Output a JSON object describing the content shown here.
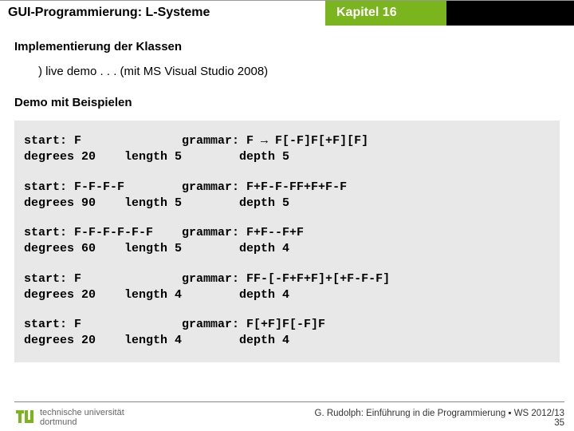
{
  "header": {
    "left": "GUI-Programmierung: L-Systeme",
    "right": "Kapitel 16"
  },
  "section1": {
    "title": "Implementierung der Klassen",
    "bullet": ") live demo . . . (mit MS Visual Studio 2008)"
  },
  "section2": {
    "title": "Demo mit Beispielen"
  },
  "examples": [
    {
      "line1": "start: F              grammar: F → F[-F]F[+F][F]",
      "line2": "degrees 20    length 5        depth 5"
    },
    {
      "line1": "start: F-F-F-F        grammar: F+F-F-FF+F+F-F",
      "line2": "degrees 90    length 5        depth 5"
    },
    {
      "line1": "start: F-F-F-F-F-F    grammar: F+F--F+F",
      "line2": "degrees 60    length 5        depth 4"
    },
    {
      "line1": "start: F              grammar: FF-[-F+F+F]+[+F-F-F]",
      "line2": "degrees 20    length 4        depth 4"
    },
    {
      "line1": "start: F              grammar: F[+F]F[-F]F",
      "line2": "degrees 20    length 4        depth 4"
    }
  ],
  "footer": {
    "logo_line1": "technische universität",
    "logo_line2": "dortmund",
    "credit": "G. Rudolph: Einführung in die Programmierung ▪ WS 2012/13",
    "page": "35"
  },
  "colors": {
    "brand_green": "#7ab51d"
  }
}
